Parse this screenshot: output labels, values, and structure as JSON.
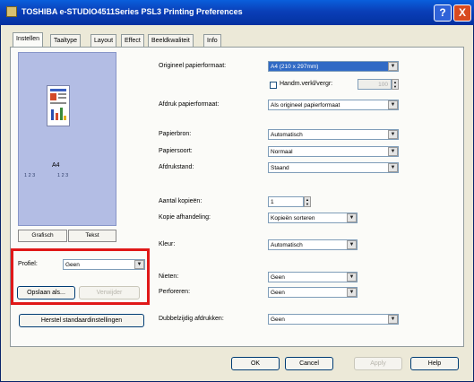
{
  "window": {
    "title": "TOSHIBA e-STUDIO4511Series PSL3 Printing Preferences",
    "help": "?",
    "close": "X"
  },
  "tabs": [
    "Instellen",
    "Taaltype",
    "Layout",
    "Effect",
    "Beeldkwaliteit",
    "Info"
  ],
  "preview": {
    "paper_label": "A4",
    "badge_left": "1 2 3",
    "badge_right": "1 2 3"
  },
  "view_buttons": {
    "graphic": "Grafisch",
    "text": "Tekst"
  },
  "profile": {
    "label": "Profiel:",
    "value": "Geen",
    "save": "Opslaan als...",
    "delete": "Verwijder"
  },
  "restore_defaults": "Herstel standaardinstellingen",
  "settings": {
    "original_size": {
      "label": "Origineel papierformaat:",
      "value": "A4 (210 x 297mm)"
    },
    "manual_feed": {
      "label": "Handm.verkl/vergr:",
      "value": "100"
    },
    "print_size": {
      "label": "Afdruk papierformaat:",
      "value": "Als origineel papierformaat"
    },
    "paper_source": {
      "label": "Papierbron:",
      "value": "Automatisch"
    },
    "paper_type": {
      "label": "Papiersoort:",
      "value": "Normaal"
    },
    "orientation": {
      "label": "Afdrukstand:",
      "value": "Staand"
    },
    "copies": {
      "label": "Aantal kopieën:",
      "value": "1"
    },
    "copy_handling": {
      "label": "Kopie afhandeling:",
      "value": "Kopieën sorteren"
    },
    "color": {
      "label": "Kleur:",
      "value": "Automatisch"
    },
    "stapling": {
      "label": "Nieten:",
      "value": "Geen"
    },
    "punching": {
      "label": "Perforeren:",
      "value": "Geen"
    },
    "duplex": {
      "label": "Dubbelzijdig afdrukken:",
      "value": "Geen"
    }
  },
  "footer": {
    "ok": "OK",
    "cancel": "Cancel",
    "apply": "Apply",
    "help": "Help"
  },
  "colors": {
    "title_bar": "#0a3fb8",
    "highlight": "#e01818",
    "selection": "#316ac5"
  }
}
